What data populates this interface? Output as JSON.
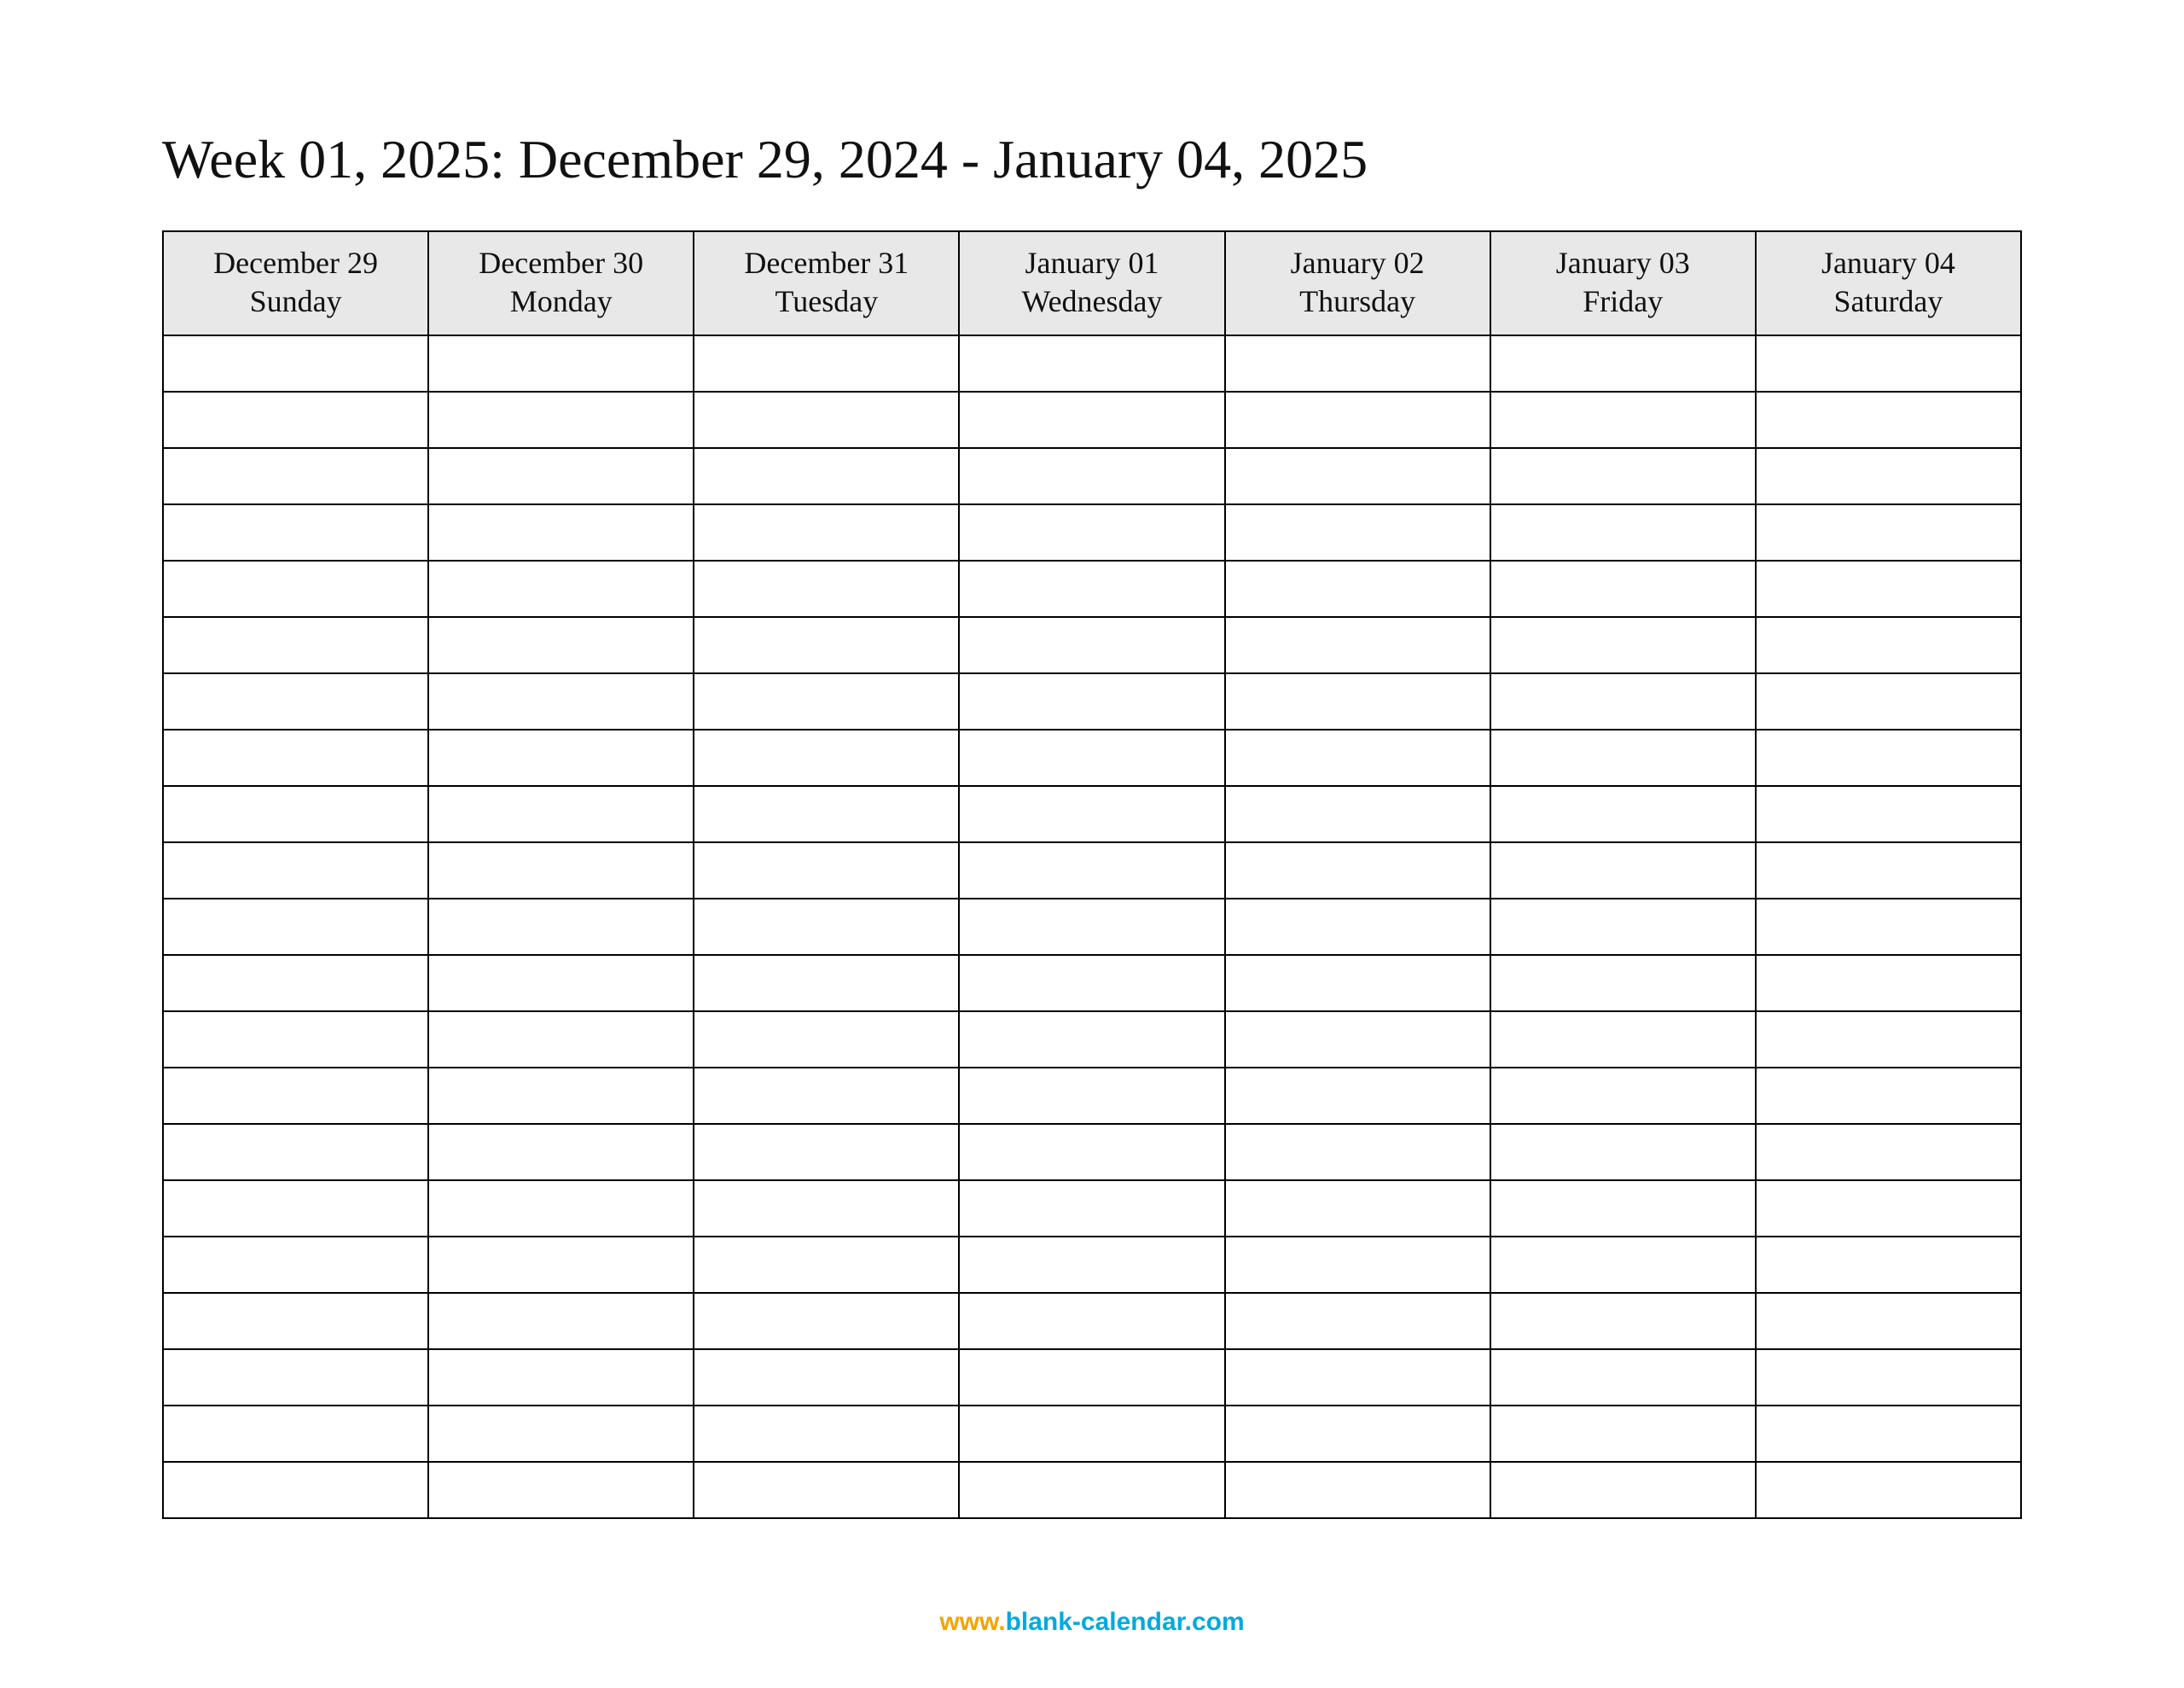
{
  "title": "Week 01, 2025: December 29, 2024 - January 04, 2025",
  "columns": [
    {
      "date": "December 29",
      "dow": "Sunday"
    },
    {
      "date": "December 30",
      "dow": "Monday"
    },
    {
      "date": "December 31",
      "dow": "Tuesday"
    },
    {
      "date": "January 01",
      "dow": "Wednesday"
    },
    {
      "date": "January 02",
      "dow": "Thursday"
    },
    {
      "date": "January 03",
      "dow": "Friday"
    },
    {
      "date": "January 04",
      "dow": "Saturday"
    }
  ],
  "body_row_count": 21,
  "footer": {
    "prefix": "www.",
    "domain": "blank-calendar.com"
  }
}
